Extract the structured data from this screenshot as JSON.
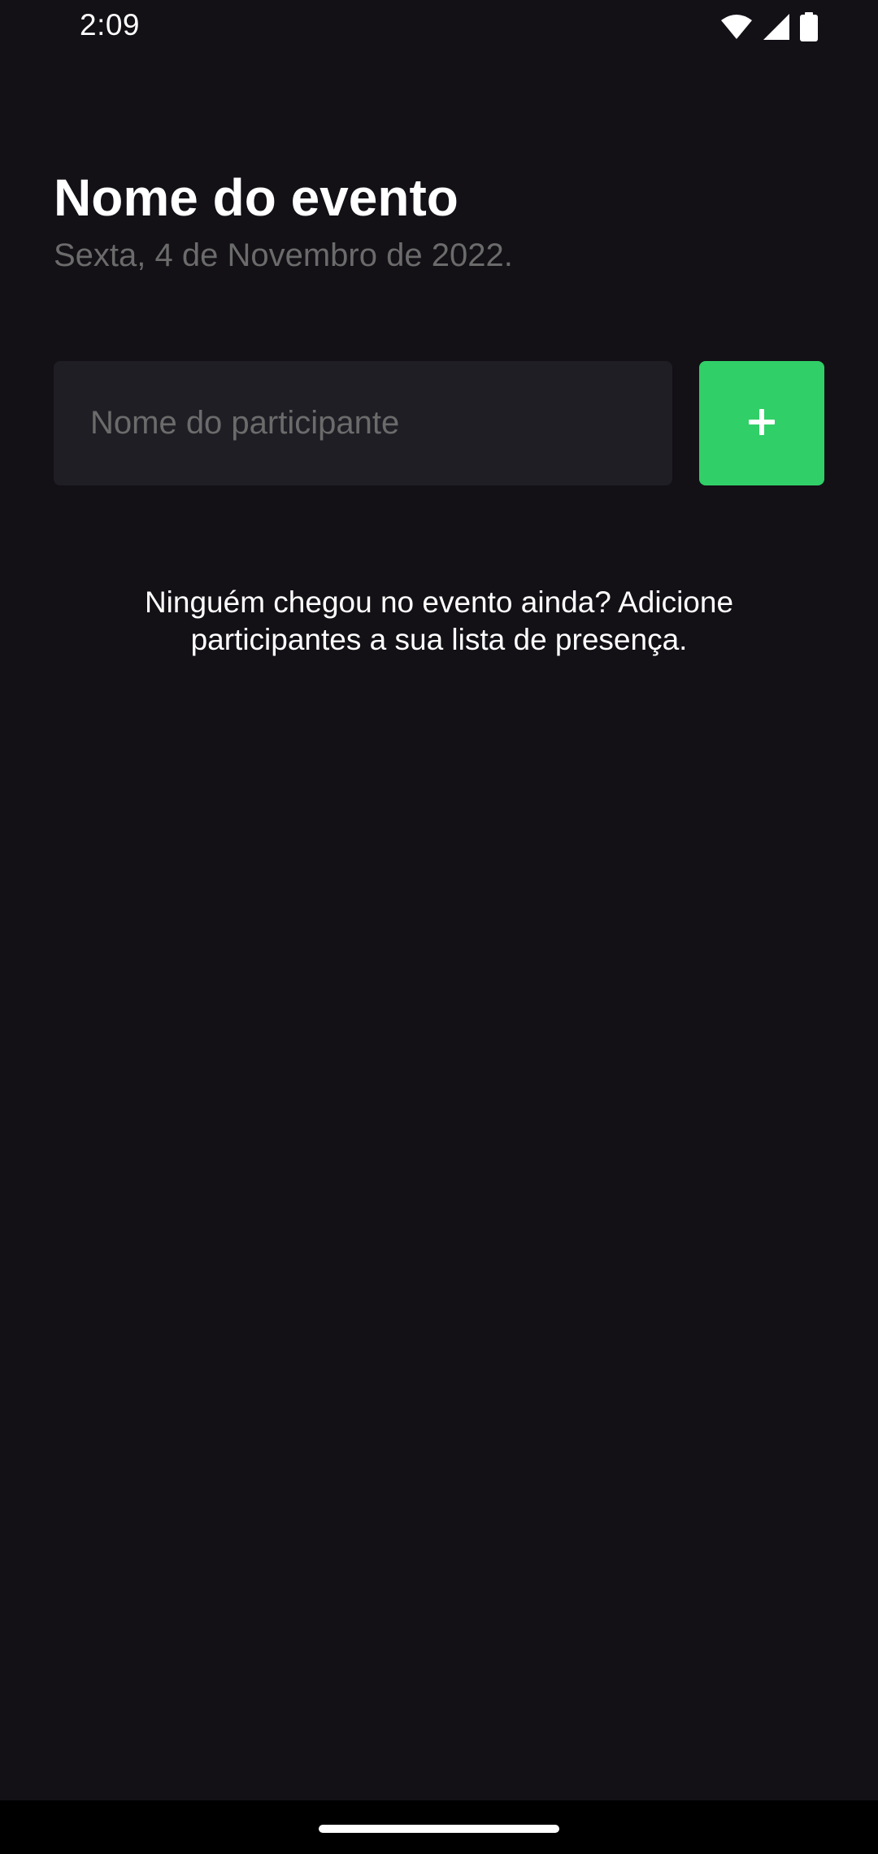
{
  "status_bar": {
    "time": "2:09",
    "icons": [
      "wifi-icon",
      "signal-icon",
      "battery-icon"
    ]
  },
  "event": {
    "title": "Nome do evento",
    "date": "Sexta, 4 de Novembro de 2022."
  },
  "participant_form": {
    "input_placeholder": "Nome do participante",
    "input_value": "",
    "add_button_icon": "plus-icon"
  },
  "empty_state": {
    "message": "Ninguém chegou no evento ainda? Adicione participantes a sua lista de presença."
  },
  "colors": {
    "background": "#131016",
    "input_background": "#1F1E25",
    "accent_green": "#31CF67",
    "secondary_text": "#6B6B6B",
    "primary_text": "#FFFFFF"
  }
}
